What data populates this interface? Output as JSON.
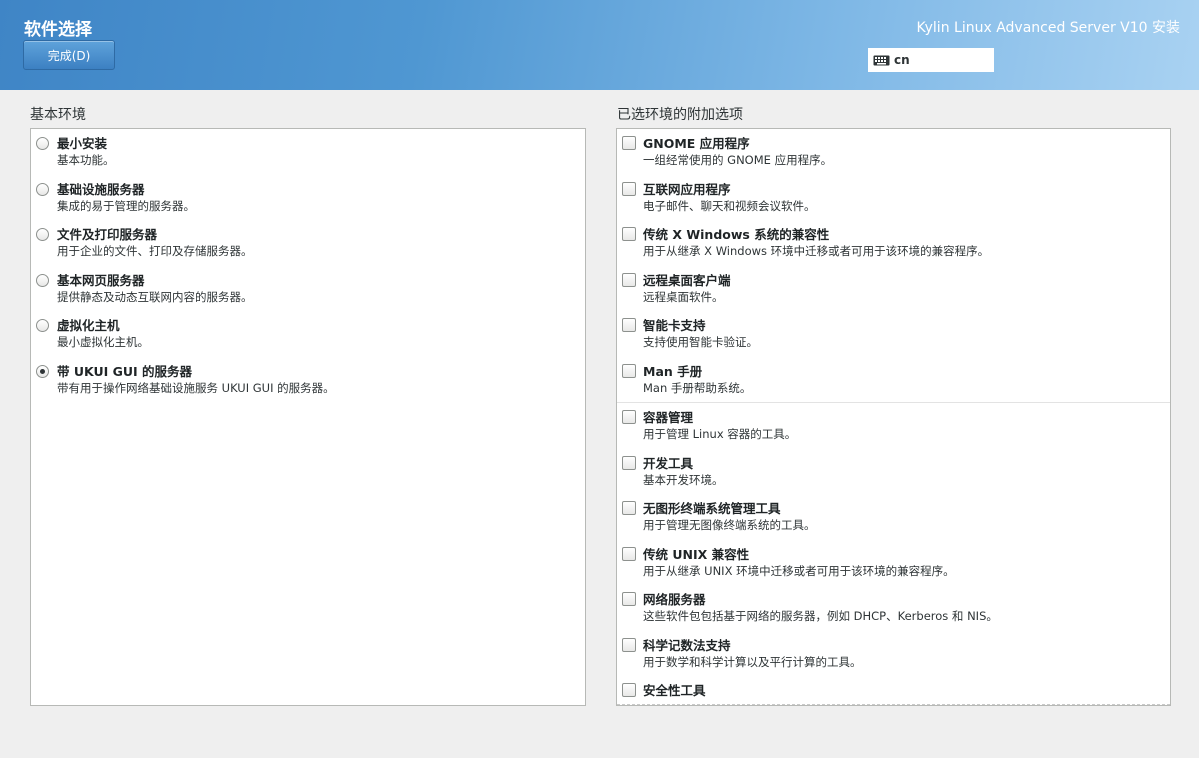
{
  "header": {
    "spoke_title": "软件选择",
    "done_label": "完成(D)",
    "product_title": "Kylin Linux Advanced Server V10 安装",
    "keyboard_layout": "cn"
  },
  "environments": {
    "title": "基本环境",
    "items": [
      {
        "name": "最小安装",
        "desc": "基本功能。",
        "selected": false
      },
      {
        "name": "基础设施服务器",
        "desc": "集成的易于管理的服务器。",
        "selected": false
      },
      {
        "name": "文件及打印服务器",
        "desc": "用于企业的文件、打印及存储服务器。",
        "selected": false
      },
      {
        "name": "基本网页服务器",
        "desc": "提供静态及动态互联网内容的服务器。",
        "selected": false
      },
      {
        "name": "虚拟化主机",
        "desc": "最小虚拟化主机。",
        "selected": false
      },
      {
        "name": "带 UKUI GUI 的服务器",
        "desc": "带有用于操作网络基础设施服务 UKUI GUI 的服务器。",
        "selected": true
      }
    ]
  },
  "addons": {
    "title": "已选环境的附加选项",
    "items": [
      {
        "name": "GNOME 应用程序",
        "desc": "一组经常使用的 GNOME 应用程序。",
        "checked": false
      },
      {
        "name": "互联网应用程序",
        "desc": "电子邮件、聊天和视频会议软件。",
        "checked": false
      },
      {
        "name": "传统 X Windows 系统的兼容性",
        "desc": "用于从继承 X Windows 环境中迁移或者可用于该环境的兼容程序。",
        "checked": false
      },
      {
        "name": "远程桌面客户端",
        "desc": "远程桌面软件。",
        "checked": false
      },
      {
        "name": "智能卡支持",
        "desc": "支持使用智能卡验证。",
        "checked": false
      },
      {
        "name": "Man 手册",
        "desc": "Man 手册帮助系统。",
        "checked": false
      },
      {
        "name": "容器管理",
        "desc": "用于管理 Linux 容器的工具。",
        "checked": false
      },
      {
        "name": "开发工具",
        "desc": "基本开发环境。",
        "checked": false
      },
      {
        "name": "无图形终端系统管理工具",
        "desc": "用于管理无图像终端系统的工具。",
        "checked": false
      },
      {
        "name": "传统 UNIX 兼容性",
        "desc": "用于从继承 UNIX 环境中迁移或者可用于该环境的兼容程序。",
        "checked": false
      },
      {
        "name": "网络服务器",
        "desc": "这些软件包包括基于网络的服务器，例如 DHCP、Kerberos 和 NIS。",
        "checked": false
      },
      {
        "name": "科学记数法支持",
        "desc": "用于数学和科学计算以及平行计算的工具。",
        "checked": false
      },
      {
        "name": "安全性工具",
        "desc": "",
        "checked": false
      }
    ]
  },
  "icons": {
    "keyboard": "keyboard-icon"
  }
}
